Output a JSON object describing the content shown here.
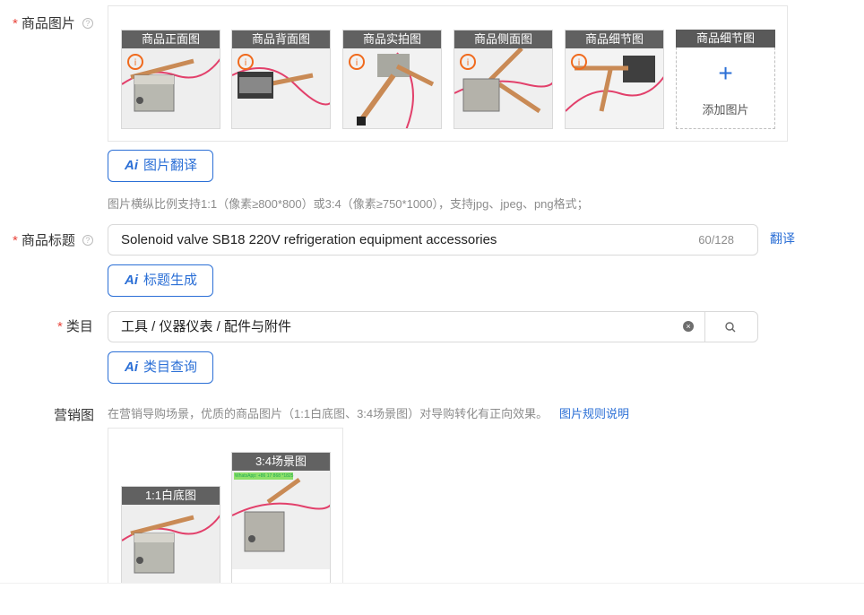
{
  "product_images": {
    "label": "商品图片",
    "thumbnails": [
      {
        "caption": "商品正面图"
      },
      {
        "caption": "商品背面图"
      },
      {
        "caption": "商品实拍图"
      },
      {
        "caption": "商品侧面图"
      },
      {
        "caption": "商品细节图"
      }
    ],
    "add_slot": {
      "caption": "商品细节图",
      "plus": "+",
      "text": "添加图片"
    },
    "ai_button": {
      "mark": "Ai",
      "label": "图片翻译"
    },
    "hint": "图片横纵比例支持1:1（像素≥800*800）或3:4（像素≥750*1000），支持jpg、jpeg、png格式；"
  },
  "product_title": {
    "label": "商品标题",
    "value": "Solenoid valve SB18 220V refrigeration equipment accessories",
    "counter": "60/128",
    "translate_link": "翻译",
    "ai_button": {
      "mark": "Ai",
      "label": "标题生成"
    }
  },
  "category": {
    "label": "类目",
    "value": "工具 / 仪器仪表 / 配件与附件",
    "clear_icon": "×",
    "search_icon": "search-icon",
    "ai_button": {
      "mark": "Ai",
      "label": "类目查询"
    }
  },
  "marketing": {
    "label": "营销图",
    "hint": "在营销导购场景，优质的商品图片（1:1白底图、3:4场景图）对导购转化有正向效果。",
    "rules_link": "图片规则说明",
    "images": [
      {
        "caption": "1:1白底图"
      },
      {
        "caption": "3:4场景图",
        "watermark": "WhatsApp: +86 17 868 *1825"
      }
    ]
  },
  "colors": {
    "accent": "#2b6fd6",
    "required": "#e8453c",
    "warning": "#f06a1d"
  }
}
